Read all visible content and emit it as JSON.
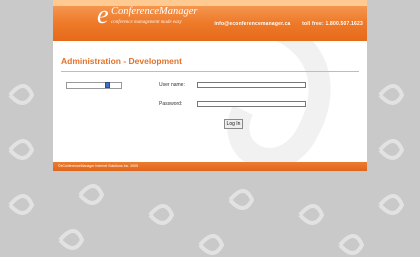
{
  "header": {
    "logo": {
      "letter": "e",
      "name": "ConferenceManager",
      "tagline": "conference management made easy"
    },
    "email": "info@econferencemanager.ca",
    "phone": "toll free: 1.800.507.1623"
  },
  "page": {
    "title": "Administration - Development"
  },
  "login": {
    "username_label": "User name:",
    "username_value": "",
    "password_label": "Password:",
    "password_value": "",
    "submit_label": "Log In",
    "language_value": ""
  },
  "footer": {
    "copyright": "©eConferenceManager Internet Solutions Inc. 2005"
  },
  "colors": {
    "brand_orange": "#ee7a2a",
    "title_orange": "#e2722a",
    "background_gray": "#c9c9c9"
  }
}
